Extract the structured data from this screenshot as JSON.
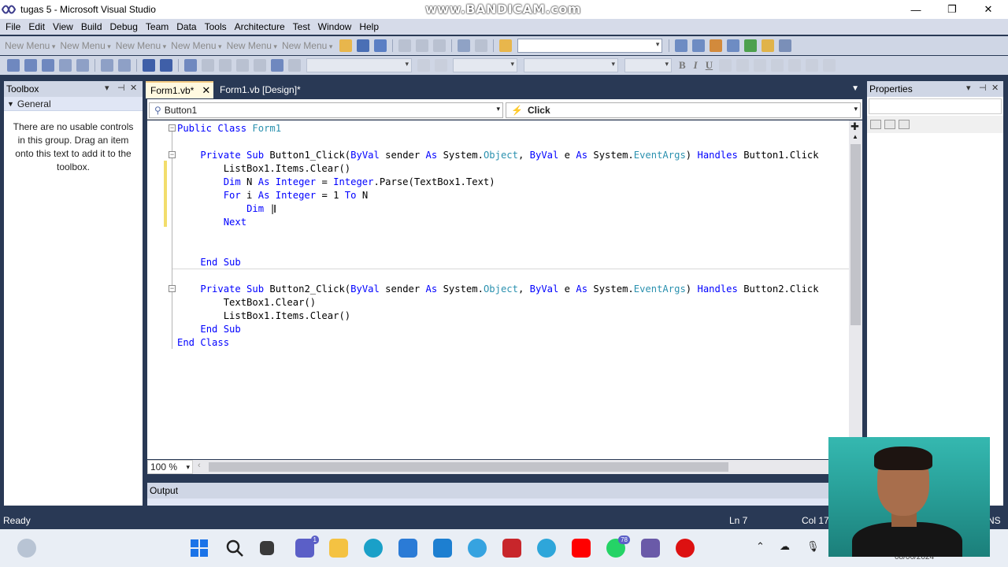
{
  "window": {
    "title": "tugas 5 - Microsoft Visual Studio",
    "watermark": "www.BANDICAM.com",
    "controls": [
      "—",
      "❐",
      "✕"
    ]
  },
  "menu": [
    "File",
    "Edit",
    "View",
    "Build",
    "Debug",
    "Team",
    "Data",
    "Tools",
    "Architecture",
    "Test",
    "Window",
    "Help"
  ],
  "toolbar1": {
    "new_menus": [
      "New Menu",
      "New Menu",
      "New Menu",
      "New Menu",
      "New Menu",
      "New Menu"
    ]
  },
  "toolbar2": {
    "format_buttons": [
      "B",
      "I",
      "U"
    ]
  },
  "toolbox": {
    "title": "Toolbox",
    "group": "General",
    "empty_message": "There are no usable controls in this group. Drag an item onto this text to add it to the toolbox."
  },
  "tabs": {
    "active": "Form1.vb*",
    "inactive": "Form1.vb [Design]*"
  },
  "navigation": {
    "object": "Button1",
    "event": "Click"
  },
  "code_lines": [
    "Public Class Form1",
    "",
    "    Private Sub Button1_Click(ByVal sender As System.Object, ByVal e As System.EventArgs) Handles Button1.Click",
    "        ListBox1.Items.Clear()",
    "        Dim N As Integer = Integer.Parse(TextBox1.Text)",
    "        For i As Integer = 1 To N",
    "            Dim |",
    "        Next",
    "",
    "",
    "    End Sub",
    "",
    "    Private Sub Button2_Click(ByVal sender As System.Object, ByVal e As System.EventArgs) Handles Button2.Click",
    "        TextBox1.Clear()",
    "        ListBox1.Items.Clear()",
    "    End Sub",
    "End Class"
  ],
  "editor": {
    "zoom": "100 %"
  },
  "output": {
    "title": "Output"
  },
  "properties": {
    "title": "Properties"
  },
  "status": {
    "state": "Ready",
    "line": "Ln 7",
    "col": "Col 17",
    "mode": "NS"
  },
  "taskbar": {
    "teams_badge": "1",
    "whatsapp_badge": "78",
    "date_partial": "08/06/2024"
  }
}
